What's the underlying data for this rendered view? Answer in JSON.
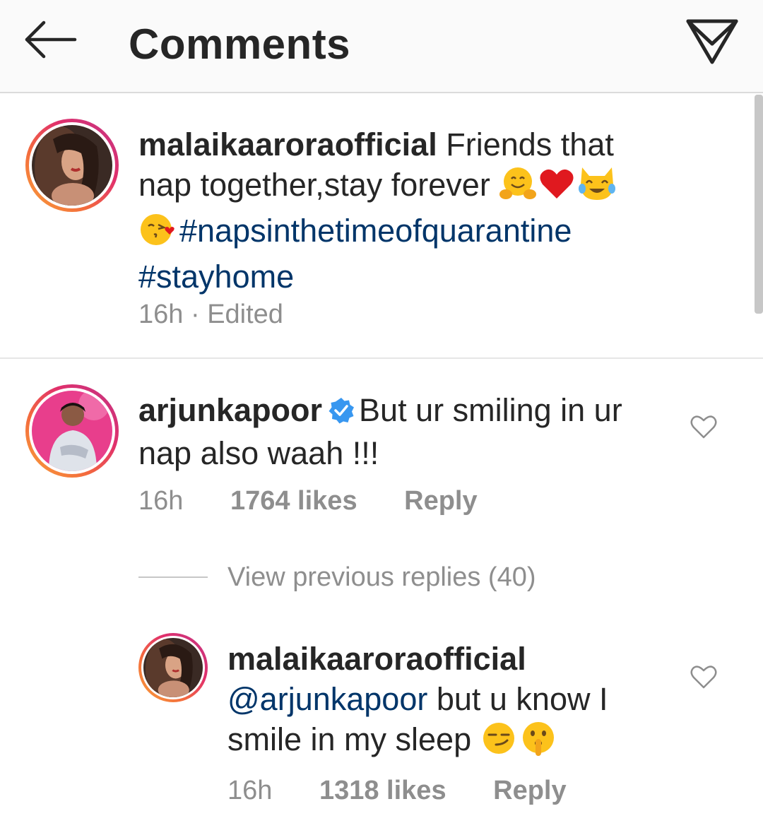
{
  "header": {
    "title": "Comments"
  },
  "caption": {
    "username": "malaikaaroraofficial",
    "text": "Friends that nap together,stay forever",
    "hashtag1": "#napsinthetimeofquarantine",
    "hashtag2": "#stayhome",
    "time": "16h",
    "separator": "·",
    "edited": "Edited",
    "emojis": [
      "hugging-face",
      "red-heart",
      "cat-tears-of-joy",
      "face-blowing-kiss"
    ]
  },
  "comment": {
    "username": "arjunkapoor",
    "verified": true,
    "text": "But ur smiling in ur nap also waah !!!",
    "time": "16h",
    "likes": "1764 likes",
    "reply": "Reply"
  },
  "view_previous": "View previous replies (40)",
  "reply": {
    "username": "malaikaaroraofficial",
    "mention": "@arjunkapoor",
    "text": " but u know I smile in my sleep",
    "time": "16h",
    "likes": "1318 likes",
    "reply": "Reply",
    "emojis": [
      "smirking-face",
      "shushing-face"
    ]
  },
  "colors": {
    "hashtag": "#003569",
    "verified": "#3897f0",
    "meta": "#8e8e8e"
  }
}
